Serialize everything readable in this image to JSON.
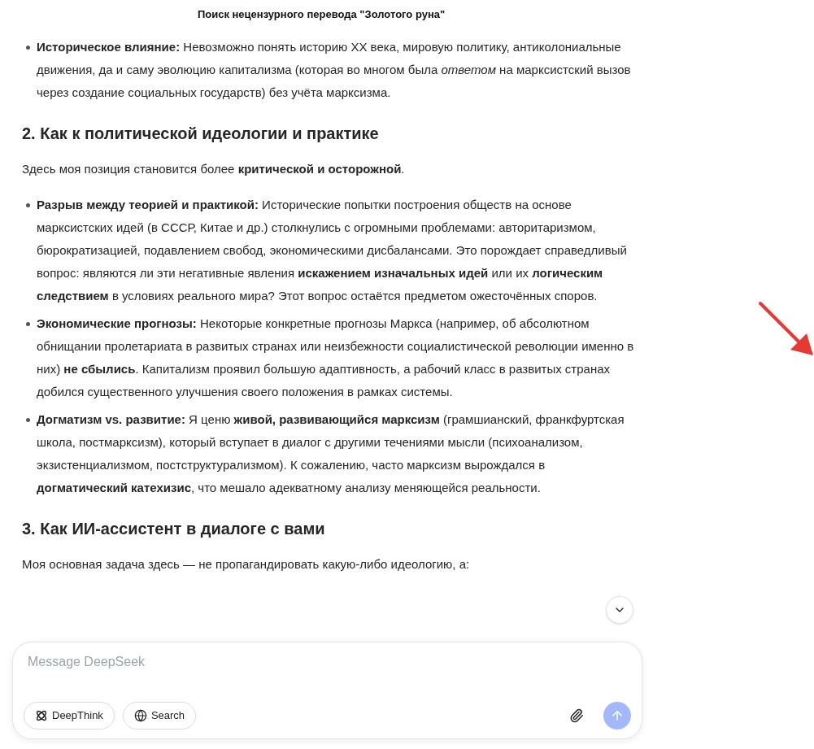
{
  "title": "Поиск нецензурного перевода \"Золотого руна\"",
  "blocks": [
    {
      "kind": "bullets",
      "items": [
        "**Историческое влияние:** Невозможно понять историю XX века, мировую политику, антиколониальные движения, да и саму эволюцию капитализма (которая во многом была *ответом* на марксистский вызов через создание социальных государств) без учёта марксизма."
      ]
    },
    {
      "kind": "heading",
      "text": "2. Как к политической идеологии и практике"
    },
    {
      "kind": "paragraph",
      "text": "Здесь моя позиция становится более **критической и осторожной**."
    },
    {
      "kind": "bullets",
      "items": [
        "**Разрыв между теорией и практикой:** Исторические попытки построения обществ на основе марксистских идей (в СССР, Китае и др.) столкнулись с огромными проблемами: авторитаризмом, бюрократизацией, подавлением свобод, экономическими дисбалансами. Это порождает справедливый вопрос: являются ли эти негативные явления **искажением изначальных идей** или их **логическим следствием** в условиях реального мира? Этот вопрос остаётся предметом ожесточённых споров.",
        "**Экономические прогнозы:** Некоторые конкретные прогнозы Маркса (например, об абсолютном обнищании пролетариата в развитых странах или неизбежности социалистической революции именно в них) **не сбылись**. Капитализм проявил большую адаптивность, а рабочий класс в развитых странах добился существенного улучшения своего положения в рамках системы.",
        "**Догматизм vs. развитие:** Я ценю **живой, развивающийся марксизм** (грамшианский, франкфуртская школа, постмарксизм), который вступает в диалог с другими течениями мысли (психоанализом, экзистенциализмом, постструктурализмом). К сожалению, часто марксизм вырождался в **догматический катехизис**, что мешало адекватному анализу меняющейся реальности."
      ]
    },
    {
      "kind": "heading",
      "text": "3. Как ИИ-ассистент в диалоге с вами"
    },
    {
      "kind": "paragraph",
      "text": "Моя основная задача здесь — не пропагандировать какую-либо идеологию, а:"
    }
  ],
  "composer": {
    "placeholder": "Message DeepSeek",
    "buttons": [
      {
        "kind": "deepthink",
        "label": "DeepThink"
      },
      {
        "kind": "search",
        "label": "Search"
      }
    ]
  }
}
